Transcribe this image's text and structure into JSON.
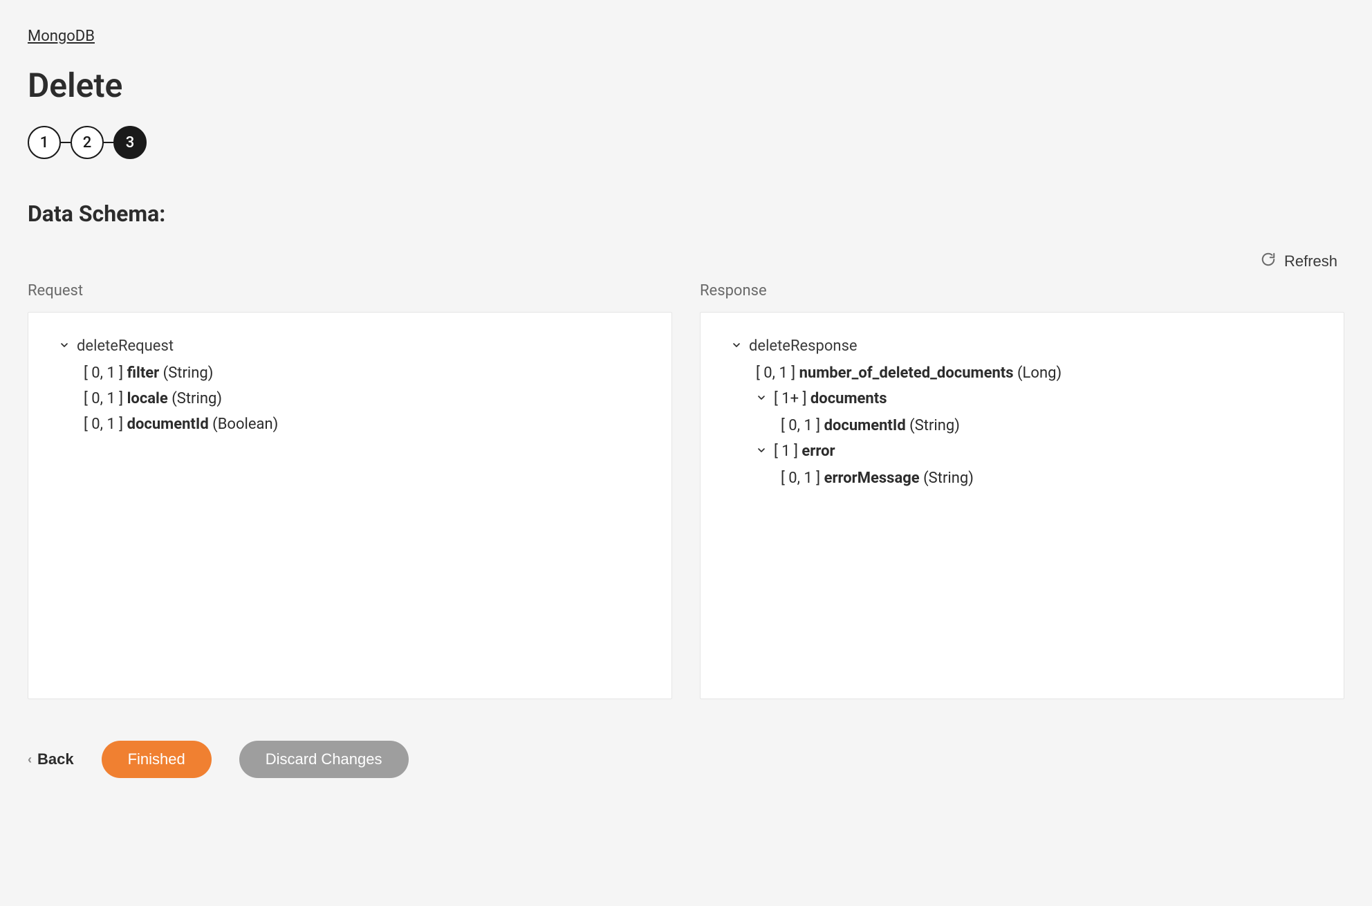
{
  "breadcrumb": "MongoDB",
  "page_title": "Delete",
  "stepper": {
    "steps": [
      "1",
      "2",
      "3"
    ],
    "active_index": 2
  },
  "section_heading": "Data Schema:",
  "refresh_label": "Refresh",
  "request": {
    "header": "Request",
    "root": {
      "name": "deleteRequest",
      "fields": [
        {
          "cardinality": "[ 0, 1 ]",
          "name": "filter",
          "type": "(String)"
        },
        {
          "cardinality": "[ 0, 1 ]",
          "name": "locale",
          "type": "(String)"
        },
        {
          "cardinality": "[ 0, 1 ]",
          "name": "documentId",
          "type": "(Boolean)"
        }
      ]
    }
  },
  "response": {
    "header": "Response",
    "root": {
      "name": "deleteResponse",
      "fields": [
        {
          "kind": "leaf",
          "cardinality": "[ 0, 1 ]",
          "name": "number_of_deleted_documents",
          "type": "(Long)"
        },
        {
          "kind": "node",
          "cardinality": "[ 1+ ]",
          "name": "documents",
          "children": [
            {
              "cardinality": "[ 0, 1 ]",
              "name": "documentId",
              "type": "(String)"
            }
          ]
        },
        {
          "kind": "node",
          "cardinality": "[ 1 ]",
          "name": "error",
          "children": [
            {
              "cardinality": "[ 0, 1 ]",
              "name": "errorMessage",
              "type": "(String)"
            }
          ]
        }
      ]
    }
  },
  "actions": {
    "back": "Back",
    "finished": "Finished",
    "discard": "Discard Changes"
  }
}
